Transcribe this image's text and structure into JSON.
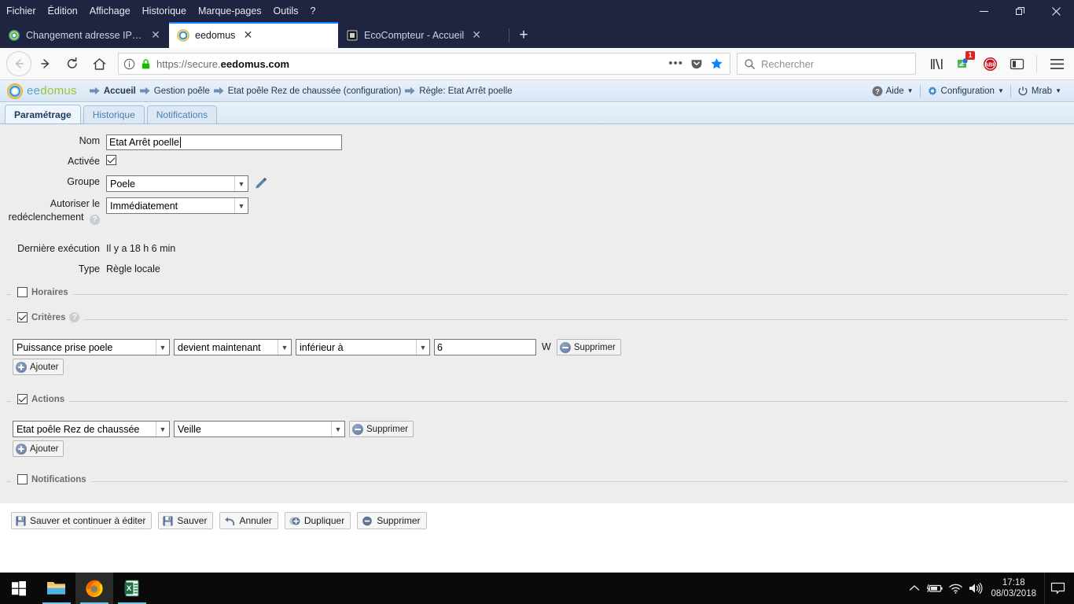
{
  "browser": {
    "menu": [
      "Fichier",
      "Édition",
      "Affichage",
      "Historique",
      "Marque-pages",
      "Outils",
      "?"
    ],
    "window_controls": {
      "minimize": "minimize-icon",
      "restore": "restore-icon",
      "close": "close-icon"
    },
    "tabs": [
      {
        "title": "Changement adresse IP box ee",
        "favicon": "eedomus-icon",
        "active": false
      },
      {
        "title": "eedomus",
        "favicon": "eedomus-icon",
        "active": true
      },
      {
        "title": "EcoCompteur - Accueil",
        "favicon": "ecocompteur-icon",
        "active": false
      }
    ],
    "new_tab_label": "+",
    "url": {
      "scheme": "https://secure.",
      "domain": "eedomus",
      "tld": ".com",
      "full": "https://secure.eedomus.com"
    },
    "search_placeholder": "Rechercher",
    "extension_badge": "1"
  },
  "app": {
    "logo": {
      "prefix": "ee",
      "suffix": "domus"
    },
    "breadcrumbs": [
      "Accueil",
      "Gestion poêle",
      "Etat poêle Rez de chaussée (configuration)",
      "Règle: Etat Arrêt poelle"
    ],
    "header_menu": [
      {
        "label": "Aide",
        "icon": "help-icon"
      },
      {
        "label": "Configuration",
        "icon": "gear-icon"
      },
      {
        "label": "Mrab",
        "icon": "power-icon"
      }
    ],
    "tabs": [
      {
        "label": "Paramétrage",
        "selected": true
      },
      {
        "label": "Historique",
        "selected": false
      },
      {
        "label": "Notifications",
        "selected": false
      }
    ],
    "form": {
      "nom": {
        "label": "Nom",
        "value": "Etat Arrêt poelle"
      },
      "activee": {
        "label": "Activée",
        "checked": true
      },
      "groupe": {
        "label": "Groupe",
        "value": "Poele",
        "edit_icon": "pencil-icon"
      },
      "autoriser": {
        "label": "Autoriser le redéclenchement",
        "value": "Immédiatement",
        "help": "?"
      },
      "derniere_execution": {
        "label": "Dernière exécution",
        "value": "Il y a 18 h 6 min"
      },
      "type": {
        "label": "Type",
        "value": "Règle locale"
      }
    },
    "sections": {
      "horaires": {
        "title": "Horaires",
        "checked": false
      },
      "criteres": {
        "title": "Critères",
        "checked": true,
        "help": "?",
        "rows": [
          {
            "device": "Puissance prise poele",
            "event": "devient maintenant",
            "operator": "inférieur à",
            "value": "6",
            "unit": "W",
            "delete_label": "Supprimer"
          }
        ],
        "add_label": "Ajouter"
      },
      "actions": {
        "title": "Actions",
        "checked": true,
        "rows": [
          {
            "device": "Etat poêle Rez de chaussée",
            "value": "Veille",
            "delete_label": "Supprimer"
          }
        ],
        "add_label": "Ajouter"
      },
      "notifications": {
        "title": "Notifications",
        "checked": false
      }
    },
    "footer_buttons": [
      {
        "label": "Sauver et continuer à éditer",
        "icon": "save-icon"
      },
      {
        "label": "Sauver",
        "icon": "save-icon"
      },
      {
        "label": "Annuler",
        "icon": "undo-icon"
      },
      {
        "label": "Dupliquer",
        "icon": "duplicate-icon"
      },
      {
        "label": "Supprimer",
        "icon": "delete-icon"
      }
    ]
  },
  "taskbar": {
    "start": "windows-start-icon",
    "items": [
      "file-explorer-icon",
      "firefox-icon",
      "excel-icon"
    ],
    "tray": [
      "chevron-up-icon",
      "battery-icon",
      "wifi-icon",
      "volume-icon"
    ],
    "time": "17:18",
    "date": "08/03/2018",
    "action_center": "notification-icon"
  }
}
